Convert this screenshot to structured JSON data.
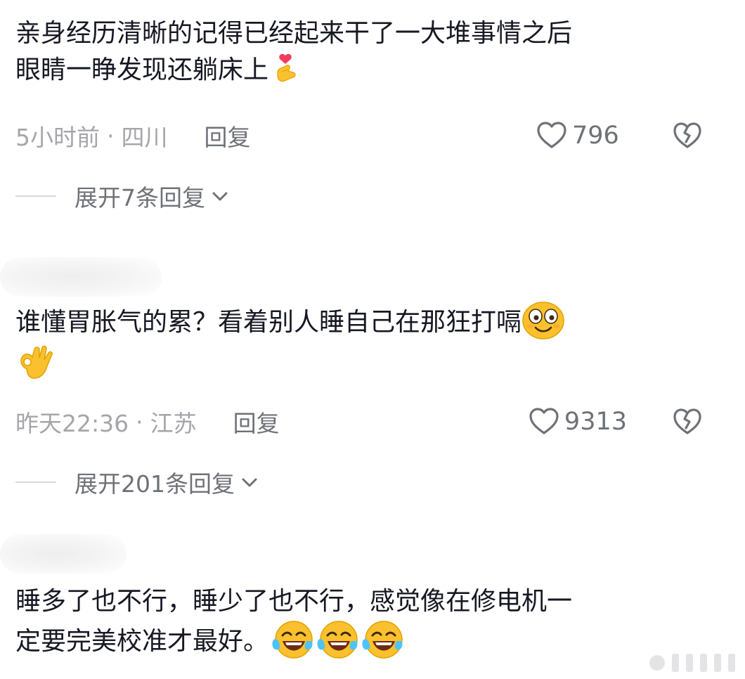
{
  "comments": [
    {
      "text_line1": "亲身经历清晰的记得已经起来干了一大堆事情之后",
      "text_line2": "眼睛一睁发现还躺床上",
      "emojis": [
        "finger-heart-icon"
      ],
      "time": "5小时前",
      "separator": "·",
      "location": "四川",
      "reply_label": "回复",
      "likes": "796",
      "expand_label": "展开7条回复"
    },
    {
      "text_line1": "谁懂胃胀气的累？看着别人睡自己在那狂打嗝",
      "emojis": [
        "smiling-face-icon",
        "ok-hand-icon"
      ],
      "time": "昨天22:36",
      "separator": "·",
      "location": "江苏",
      "reply_label": "回复",
      "likes": "9313",
      "expand_label": "展开201条回复"
    },
    {
      "text_line1": "睡多了也不行，睡少了也不行，感觉像在修电机一",
      "text_line2": "定要完美校准才最好。",
      "emojis": [
        "tears-of-joy-icon",
        "tears-of-joy-icon",
        "tears-of-joy-icon"
      ]
    }
  ],
  "colors": {
    "text": "#161823",
    "meta": "#a5a6aa",
    "secondary": "#6f7178",
    "icon_stroke": "#6f7178",
    "emoji_yellow": "#fbc02d"
  }
}
